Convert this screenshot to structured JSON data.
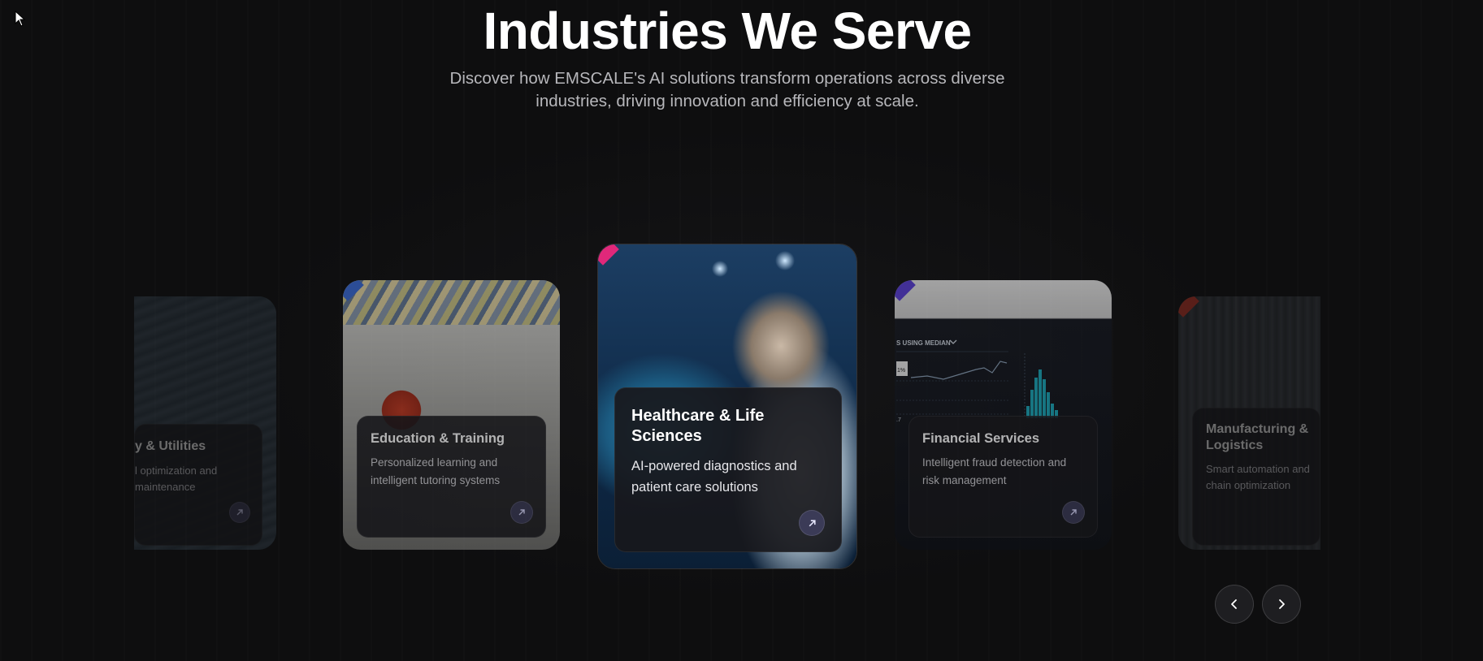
{
  "header": {
    "title": "Industries We Serve",
    "subtitle": "Discover how EMSCALE's AI solutions transform operations across diverse industries, driving innovation and efficiency at scale."
  },
  "cards": [
    {
      "title": "y & Utilities",
      "description": "l optimization and maintenance",
      "ribbon_color": "#3b6bd6",
      "icon": "arrow-up-right-icon"
    },
    {
      "title": "Education & Training",
      "description": "Personalized learning and intelligent tutoring systems",
      "ribbon_color": "#3b6bd6",
      "icon": "arrow-up-right-icon"
    },
    {
      "title": "Healthcare & Life Sciences",
      "description": "AI-powered diagnostics and patient care solutions",
      "ribbon_color": "#e0287a",
      "icon": "arrow-up-right-icon"
    },
    {
      "title": "Financial Services",
      "description": "Intelligent fraud detection and risk management",
      "ribbon_color": "#5a3fd6",
      "icon": "arrow-up-right-icon",
      "screen_text": {
        "heading": "S USING MEDIAN",
        "badge": "1%",
        "value": ".7"
      }
    },
    {
      "title": "Manufacturing & Logistics",
      "description": "Smart automation and chain optimization",
      "ribbon_color": "#d23a2a",
      "icon": "arrow-up-right-icon"
    }
  ],
  "navigation": {
    "prev_icon": "chevron-left-icon",
    "next_icon": "chevron-right-icon"
  },
  "colors": {
    "background": "#0e0e0f",
    "accent_button": "#3b3b57"
  }
}
